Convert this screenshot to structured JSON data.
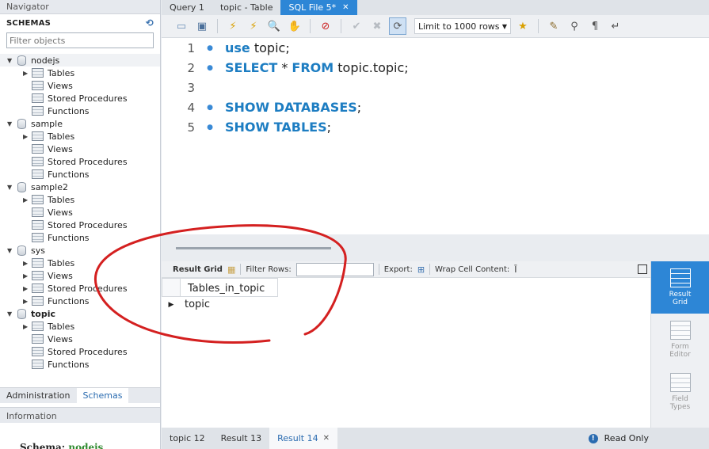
{
  "navigator": {
    "title": "Navigator",
    "schemas_label": "SCHEMAS",
    "filter_placeholder": "Filter objects",
    "schemas": [
      {
        "name": "nodejs",
        "bold": false,
        "children": [
          "Tables",
          "Views",
          "Stored Procedures",
          "Functions"
        ]
      },
      {
        "name": "sample",
        "bold": false,
        "children": [
          "Tables",
          "Views",
          "Stored Procedures",
          "Functions"
        ]
      },
      {
        "name": "sample2",
        "bold": false,
        "children": [
          "Tables",
          "Views",
          "Stored Procedures",
          "Functions"
        ]
      },
      {
        "name": "sys",
        "bold": false,
        "children": [
          "Tables",
          "Views",
          "Stored Procedures",
          "Functions"
        ]
      },
      {
        "name": "topic",
        "bold": true,
        "children": [
          "Tables",
          "Views",
          "Stored Procedures",
          "Functions"
        ]
      }
    ],
    "tabs": [
      "Administration",
      "Schemas"
    ],
    "active_tab": "Schemas",
    "info_title": "Information",
    "info_schema_label": "Schema:",
    "info_schema_value": "nodejs"
  },
  "doc_tabs": [
    {
      "label": "Query 1",
      "active": false
    },
    {
      "label": "topic - Table",
      "active": false
    },
    {
      "label": "SQL File 5*",
      "active": true
    }
  ],
  "toolbar": {
    "limit_label": "Limit to 1000 rows"
  },
  "editor": {
    "lines": [
      {
        "num": "1",
        "dot": true,
        "kw1": "use",
        "rest": " topic;"
      },
      {
        "num": "2",
        "dot": true,
        "kw1": "SELECT",
        "mid": " * ",
        "kw2": "FROM",
        "rest": " topic.topic;"
      },
      {
        "num": "3",
        "dot": false
      },
      {
        "num": "4",
        "dot": true,
        "kw1": "SHOW DATABASES",
        "rest": ";"
      },
      {
        "num": "5",
        "dot": true,
        "kw1": "SHOW TABLES",
        "rest": ";"
      }
    ]
  },
  "result_toolbar": {
    "result_grid": "Result Grid",
    "filter_rows": "Filter Rows:",
    "export": "Export:",
    "wrap": "Wrap Cell Content:"
  },
  "grid": {
    "column": "Tables_in_topic",
    "rows": [
      "topic"
    ]
  },
  "side_panel": {
    "result_grid": "Result Grid",
    "form_editor": "Form Editor",
    "field_types": "Field Types"
  },
  "bottom_tabs": [
    {
      "label": "topic 12",
      "active": false
    },
    {
      "label": "Result 13",
      "active": false
    },
    {
      "label": "Result 14",
      "active": true
    }
  ],
  "status": "Read Only",
  "colors": {
    "accent": "#2d86d6",
    "keyword": "#1d7dc2",
    "annotation": "#d42020"
  }
}
